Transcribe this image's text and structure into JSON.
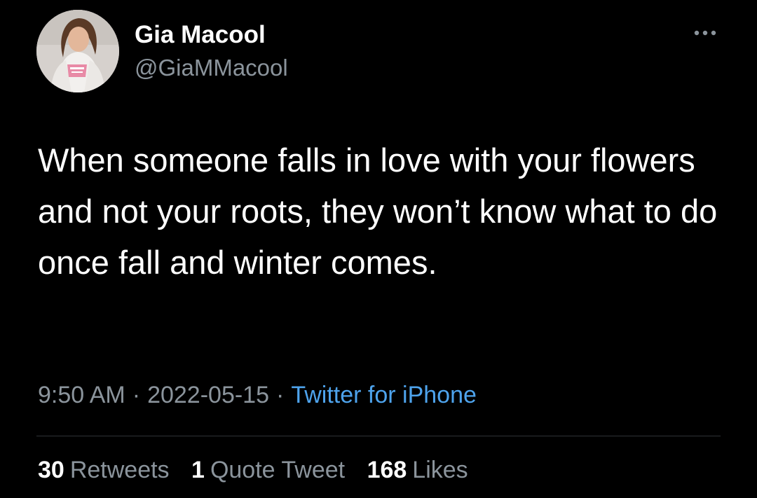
{
  "author": {
    "name": "Gia Macool",
    "handle": "@GiaMMacool"
  },
  "tweet": {
    "text": "When someone falls in love with your flowers and not your roots, they won’t know what to do once fall and winter comes."
  },
  "meta": {
    "time": "9:50 AM",
    "separator": "·",
    "date": "2022-05-15",
    "source": "Twitter for iPhone"
  },
  "stats": {
    "retweets": {
      "count": "30",
      "label": "Retweets"
    },
    "quotes": {
      "count": "1",
      "label": "Quote Tweet"
    },
    "likes": {
      "count": "168",
      "label": "Likes"
    }
  },
  "icons": {
    "more": "more-options-icon"
  },
  "colors": {
    "background": "#000000",
    "primary_text": "#ffffff",
    "secondary_text": "#8b949c",
    "link": "#4ea3ec",
    "divider": "#2f3336"
  }
}
